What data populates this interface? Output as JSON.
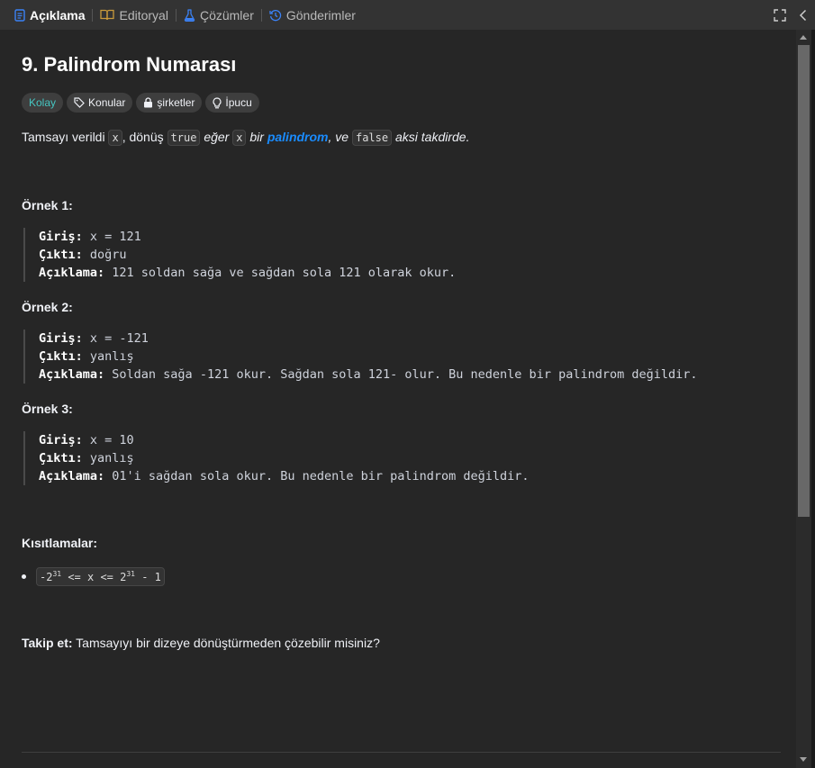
{
  "tabs": [
    {
      "label": "Açıklama",
      "icon": "document-icon",
      "color": "#3b82f6"
    },
    {
      "label": "Editoryal",
      "icon": "book-icon",
      "color": "#c99a3b"
    },
    {
      "label": "Çözümler",
      "icon": "flask-icon",
      "color": "#3b82f6"
    },
    {
      "label": "Gönderimler",
      "icon": "history-icon",
      "color": "#3b82f6"
    }
  ],
  "problem": {
    "title": "9. Palindrom Numarası",
    "tags": {
      "difficulty": "Kolay",
      "topics": "Konular",
      "companies": "şirketler",
      "hint": "İpucu"
    },
    "description": {
      "p1": "Tamsayı verildi ",
      "c1": "x",
      "p2": ", dönüş ",
      "c2": "true",
      "p3": " eğer ",
      "c3": "x",
      "p4": " bir ",
      "link": "palindrom",
      "p5": ", ve ",
      "c4": "false",
      "p6": " aksi takdirde."
    },
    "examples": [
      {
        "title": "Örnek 1:",
        "input_label": "Giriş:",
        "input": " x = 121",
        "output_label": "Çıktı:",
        "output": " doğru",
        "explanation_label": "Açıklama:",
        "explanation": " 121 soldan sağa ve sağdan sola 121 olarak okur."
      },
      {
        "title": "Örnek 2:",
        "input_label": "Giriş:",
        "input": " x = -121",
        "output_label": "Çıktı:",
        "output": " yanlış",
        "explanation_label": "Açıklama:",
        "explanation": " Soldan sağa -121 okur. Sağdan sola 121- olur. Bu nedenle bir palindrom değildir."
      },
      {
        "title": "Örnek 3:",
        "input_label": "Giriş:",
        "input": " x = 10",
        "output_label": "Çıktı:",
        "output": " yanlış",
        "explanation_label": "Açıklama:",
        "explanation": " 01'i sağdan sola okur. Bu nedenle bir palindrom değildir."
      }
    ],
    "constraints_title": "Kısıtlamalar:",
    "constraint": {
      "part1": "-2",
      "exp1": "31",
      "part2": " <= x <= 2",
      "exp2": "31",
      "part3": " - 1"
    },
    "followup_label": "Takip et:",
    "followup_text": " Tamsayıyı bir dizeye dönüştürmeden çözebilir misiniz?"
  }
}
